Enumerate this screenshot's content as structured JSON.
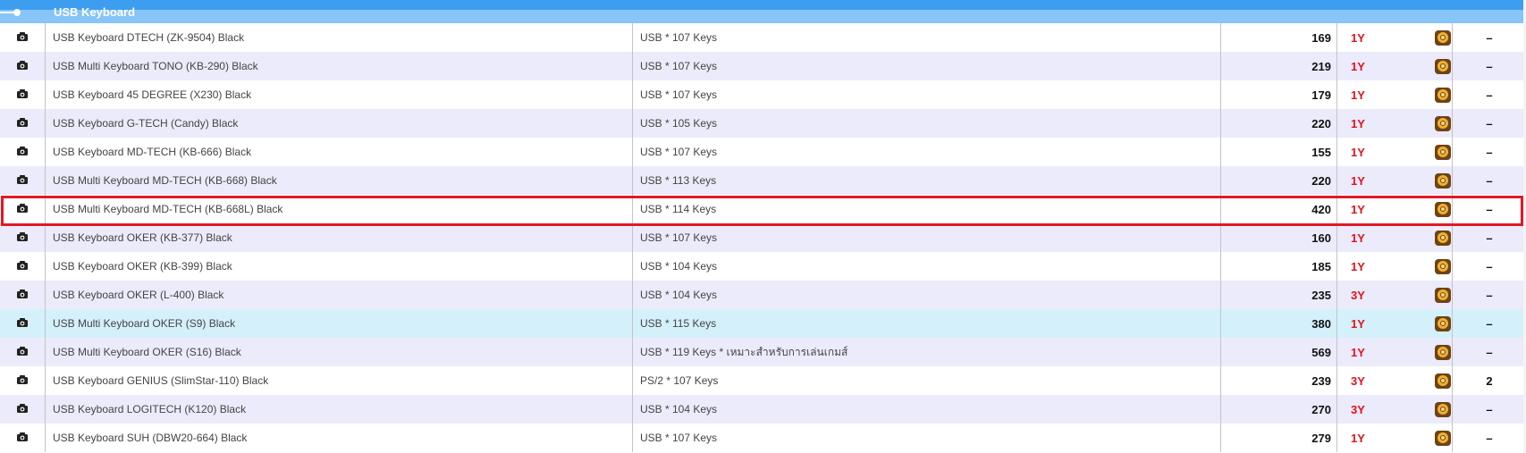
{
  "header": {
    "title": "USB Keyboard"
  },
  "icons": {
    "camera": "camera-icon",
    "badge": "store-badge-icon",
    "toggle": "toggle-icon"
  },
  "colors": {
    "header": "#3d9ef0",
    "header_light": "#87c4f7",
    "warranty": "#e4121b",
    "selection": "#e11927",
    "row_alt": "#ebebfb",
    "row_hover": "#d4f0fb"
  },
  "products": [
    {
      "name": "USB Keyboard DTECH (ZK-9504) Black",
      "spec": "USB * 107 Keys",
      "price": "169",
      "warranty": "1Y",
      "stock": "–"
    },
    {
      "name": "USB Multi Keyboard TONO (KB-290) Black",
      "spec": "USB * 107 Keys",
      "price": "219",
      "warranty": "1Y",
      "stock": "–"
    },
    {
      "name": "USB Keyboard 45 DEGREE (X230) Black",
      "spec": "USB * 107 Keys",
      "price": "179",
      "warranty": "1Y",
      "stock": "–"
    },
    {
      "name": "USB Keyboard G-TECH (Candy) Black",
      "spec": "USB * 105 Keys",
      "price": "220",
      "warranty": "1Y",
      "stock": "–"
    },
    {
      "name": "USB Keyboard MD-TECH (KB-666) Black",
      "spec": "USB * 107 Keys",
      "price": "155",
      "warranty": "1Y",
      "stock": "–"
    },
    {
      "name": "USB Multi Keyboard MD-TECH (KB-668) Black",
      "spec": "USB * 113 Keys",
      "price": "220",
      "warranty": "1Y",
      "stock": "–"
    },
    {
      "name": "USB Multi Keyboard MD-TECH (KB-668L) Black",
      "spec": "USB * 114 Keys",
      "price": "420",
      "warranty": "1Y",
      "stock": "–"
    },
    {
      "name": "USB Keyboard OKER (KB-377) Black",
      "spec": "USB * 107 Keys",
      "price": "160",
      "warranty": "1Y",
      "stock": "–"
    },
    {
      "name": "USB Keyboard OKER (KB-399) Black",
      "spec": "USB * 104 Keys",
      "price": "185",
      "warranty": "1Y",
      "stock": "–"
    },
    {
      "name": "USB Keyboard OKER (L-400) Black",
      "spec": "USB * 104 Keys",
      "price": "235",
      "warranty": "3Y",
      "stock": "–"
    },
    {
      "name": "USB Multi Keyboard OKER (S9) Black",
      "spec": "USB * 115 Keys",
      "price": "380",
      "warranty": "1Y",
      "stock": "–"
    },
    {
      "name": "USB Multi Keyboard OKER (S16) Black",
      "spec": "USB * 119 Keys * เหมาะสำหรับการเล่นเกมส์",
      "price": "569",
      "warranty": "1Y",
      "stock": "–"
    },
    {
      "name": "USB Keyboard GENIUS (SlimStar-110) Black",
      "spec": "PS/2 * 107 Keys",
      "price": "239",
      "warranty": "3Y",
      "stock": "2"
    },
    {
      "name": "USB Keyboard LOGITECH (K120) Black",
      "spec": "USB * 104 Keys",
      "price": "270",
      "warranty": "3Y",
      "stock": "–"
    },
    {
      "name": "USB Keyboard SUH (DBW20-664) Black",
      "spec": "USB * 107 Keys",
      "price": "279",
      "warranty": "1Y",
      "stock": "–"
    }
  ]
}
